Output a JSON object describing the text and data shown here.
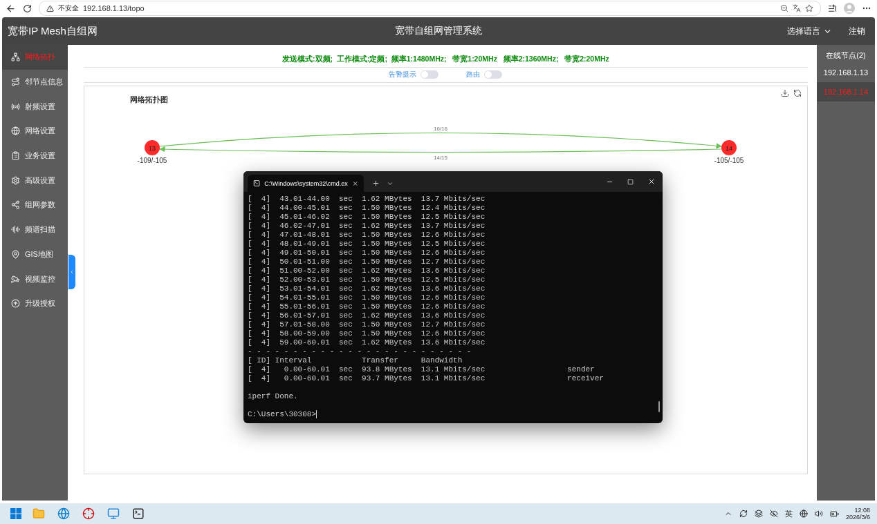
{
  "browser": {
    "security": "不安全",
    "url": "192.168.1.13/topo"
  },
  "header": {
    "title": "宽带IP Mesh自组网",
    "center_title": "宽带自组网管理系统",
    "language": "选择语言",
    "logout": "注销"
  },
  "sidebar": {
    "items": [
      {
        "label": "网络拓扑",
        "selected": true
      },
      {
        "label": "邻节点信息",
        "selected": false
      },
      {
        "label": "射频设置",
        "selected": false
      },
      {
        "label": "网络设置",
        "selected": false
      },
      {
        "label": "业务设置",
        "selected": false
      },
      {
        "label": "高级设置",
        "selected": false
      },
      {
        "label": "组网参数",
        "selected": false
      },
      {
        "label": "频谱扫描",
        "selected": false
      },
      {
        "label": "GIS地图",
        "selected": false
      },
      {
        "label": "视频监控",
        "selected": false
      },
      {
        "label": "升级授权",
        "selected": false
      }
    ]
  },
  "status_line": "发送模式:双频;  工作模式:定频;  频率1:1480MHz;   带宽1:20MHz   频率2:1360MHz;   带宽2:20MHz",
  "toggles": [
    {
      "label": "告警提示",
      "on": false
    },
    {
      "label": "路由",
      "on": false
    }
  ],
  "topology": {
    "title": "网络拓扑图",
    "nodes": [
      {
        "label": "13",
        "reading": "-109/-105"
      },
      {
        "label": "14",
        "reading": "-105/-105"
      }
    ],
    "links": [
      {
        "label": "16/16"
      },
      {
        "label": "14/15"
      }
    ]
  },
  "online_nodes": {
    "title": "在线节点(2)",
    "items": [
      {
        "address": "192.168.1.13",
        "selected": false
      },
      {
        "address": "192.168.1.14",
        "selected": true
      }
    ]
  },
  "terminal": {
    "tab_title": "C:\\Windows\\system32\\cmd.ex",
    "lines": [
      "[  4]  43.01-44.00  sec  1.62 MBytes  13.7 Mbits/sec",
      "[  4]  44.00-45.01  sec  1.50 MBytes  12.4 Mbits/sec",
      "[  4]  45.01-46.02  sec  1.50 MBytes  12.5 Mbits/sec",
      "[  4]  46.02-47.01  sec  1.62 MBytes  13.7 Mbits/sec",
      "[  4]  47.01-48.01  sec  1.50 MBytes  12.6 Mbits/sec",
      "[  4]  48.01-49.01  sec  1.50 MBytes  12.5 Mbits/sec",
      "[  4]  49.01-50.01  sec  1.50 MBytes  12.6 Mbits/sec",
      "[  4]  50.01-51.00  sec  1.50 MBytes  12.7 Mbits/sec",
      "[  4]  51.00-52.00  sec  1.62 MBytes  13.6 Mbits/sec",
      "[  4]  52.00-53.01  sec  1.50 MBytes  12.5 Mbits/sec",
      "[  4]  53.01-54.01  sec  1.62 MBytes  13.6 Mbits/sec",
      "[  4]  54.01-55.01  sec  1.50 MBytes  12.6 Mbits/sec",
      "[  4]  55.01-56.01  sec  1.50 MBytes  12.6 Mbits/sec",
      "[  4]  56.01-57.01  sec  1.62 MBytes  13.6 Mbits/sec",
      "[  4]  57.01-58.00  sec  1.50 MBytes  12.7 Mbits/sec",
      "[  4]  58.00-59.00  sec  1.50 MBytes  12.6 Mbits/sec",
      "[  4]  59.00-60.01  sec  1.62 MBytes  13.6 Mbits/sec",
      "- - - - - - - - - - - - - - - - - - - - - - - - -",
      "[ ID] Interval           Transfer     Bandwidth",
      "[  4]   0.00-60.01  sec  93.8 MBytes  13.1 Mbits/sec                  sender",
      "[  4]   0.00-60.01  sec  93.7 MBytes  13.1 Mbits/sec                  receiver"
    ],
    "done": "iperf Done.",
    "prompt": "C:\\Users\\30308>"
  },
  "taskbar": {
    "ime": "英",
    "time": "12:08",
    "date": "2026/3/6"
  }
}
